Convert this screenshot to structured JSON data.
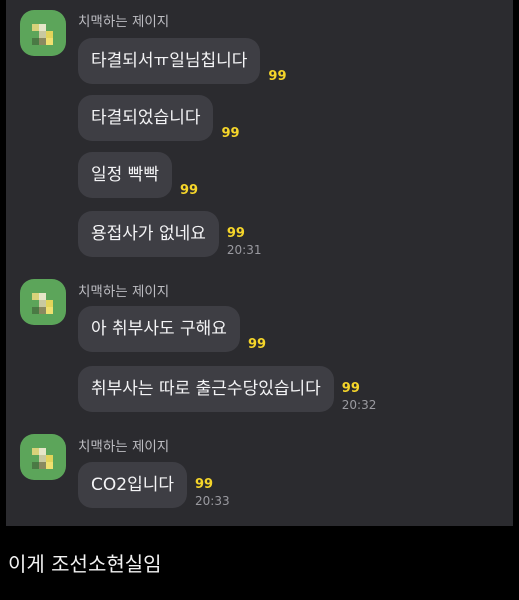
{
  "groups": [
    {
      "sender": "치맥하는 제이지",
      "messages": [
        {
          "text": "타결되서ㅠ일님칩니다",
          "unread": "99",
          "time": ""
        },
        {
          "text": "타결되었습니다",
          "unread": "99",
          "time": ""
        },
        {
          "text": "일정 빡빡",
          "unread": "99",
          "time": ""
        },
        {
          "text": "용접사가 없네요",
          "unread": "99",
          "time": "20:31"
        }
      ]
    },
    {
      "sender": "치맥하는 제이지",
      "messages": [
        {
          "text": "아 취부사도 구해요",
          "unread": "99",
          "time": ""
        },
        {
          "text": "취부사는 따로 출근수당있습니다",
          "unread": "99",
          "time": "20:32"
        }
      ]
    },
    {
      "sender": "치맥하는 제이지",
      "messages": [
        {
          "text": "CO2입니다",
          "unread": "99",
          "time": "20:33"
        }
      ]
    }
  ],
  "caption": "이게 조선소현실임",
  "colors": {
    "chat_background": "#2b2b2f",
    "bubble": "#3e3e44",
    "unread_count": "#f5d52a",
    "avatar": "#5ca55a"
  }
}
